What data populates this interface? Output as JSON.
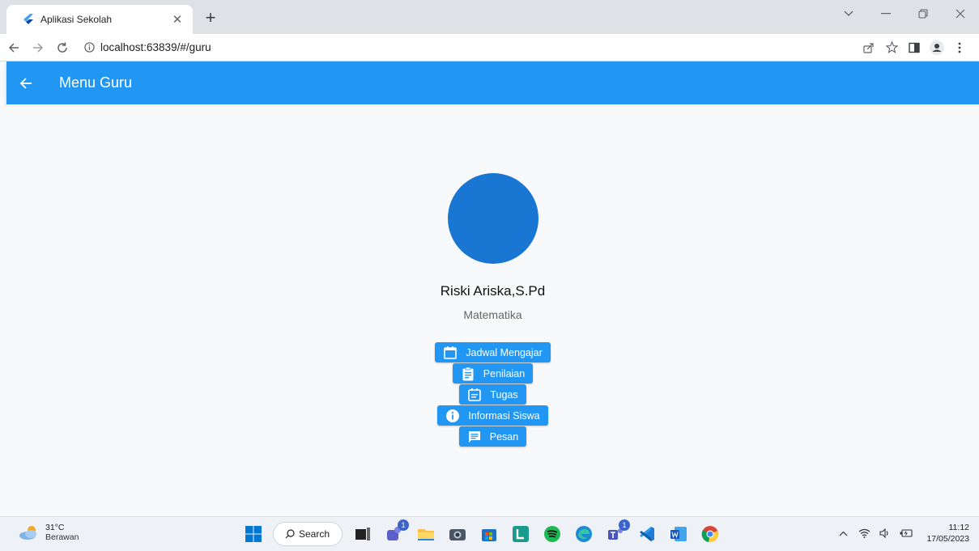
{
  "browser": {
    "tab_title": "Aplikasi Sekolah",
    "url": "localhost:63839/#/guru"
  },
  "appbar": {
    "title": "Menu Guru"
  },
  "profile": {
    "name": "Riski Ariska,S.Pd",
    "subject": "Matematika",
    "avatar_color": "#1976d2"
  },
  "menu": {
    "items": [
      {
        "label": "Jadwal Mengajar",
        "icon": "calendar-icon"
      },
      {
        "label": "Penilaian",
        "icon": "clipboard-icon"
      },
      {
        "label": "Tugas",
        "icon": "event-note-icon"
      },
      {
        "label": "Informasi Siswa",
        "icon": "info-icon"
      },
      {
        "label": "Pesan",
        "icon": "message-icon"
      }
    ]
  },
  "taskbar": {
    "weather_temp": "31°C",
    "weather_desc": "Berawan",
    "search_label": "Search",
    "time": "11:12",
    "date": "17/05/2023"
  },
  "colors": {
    "primary": "#2196f3"
  }
}
